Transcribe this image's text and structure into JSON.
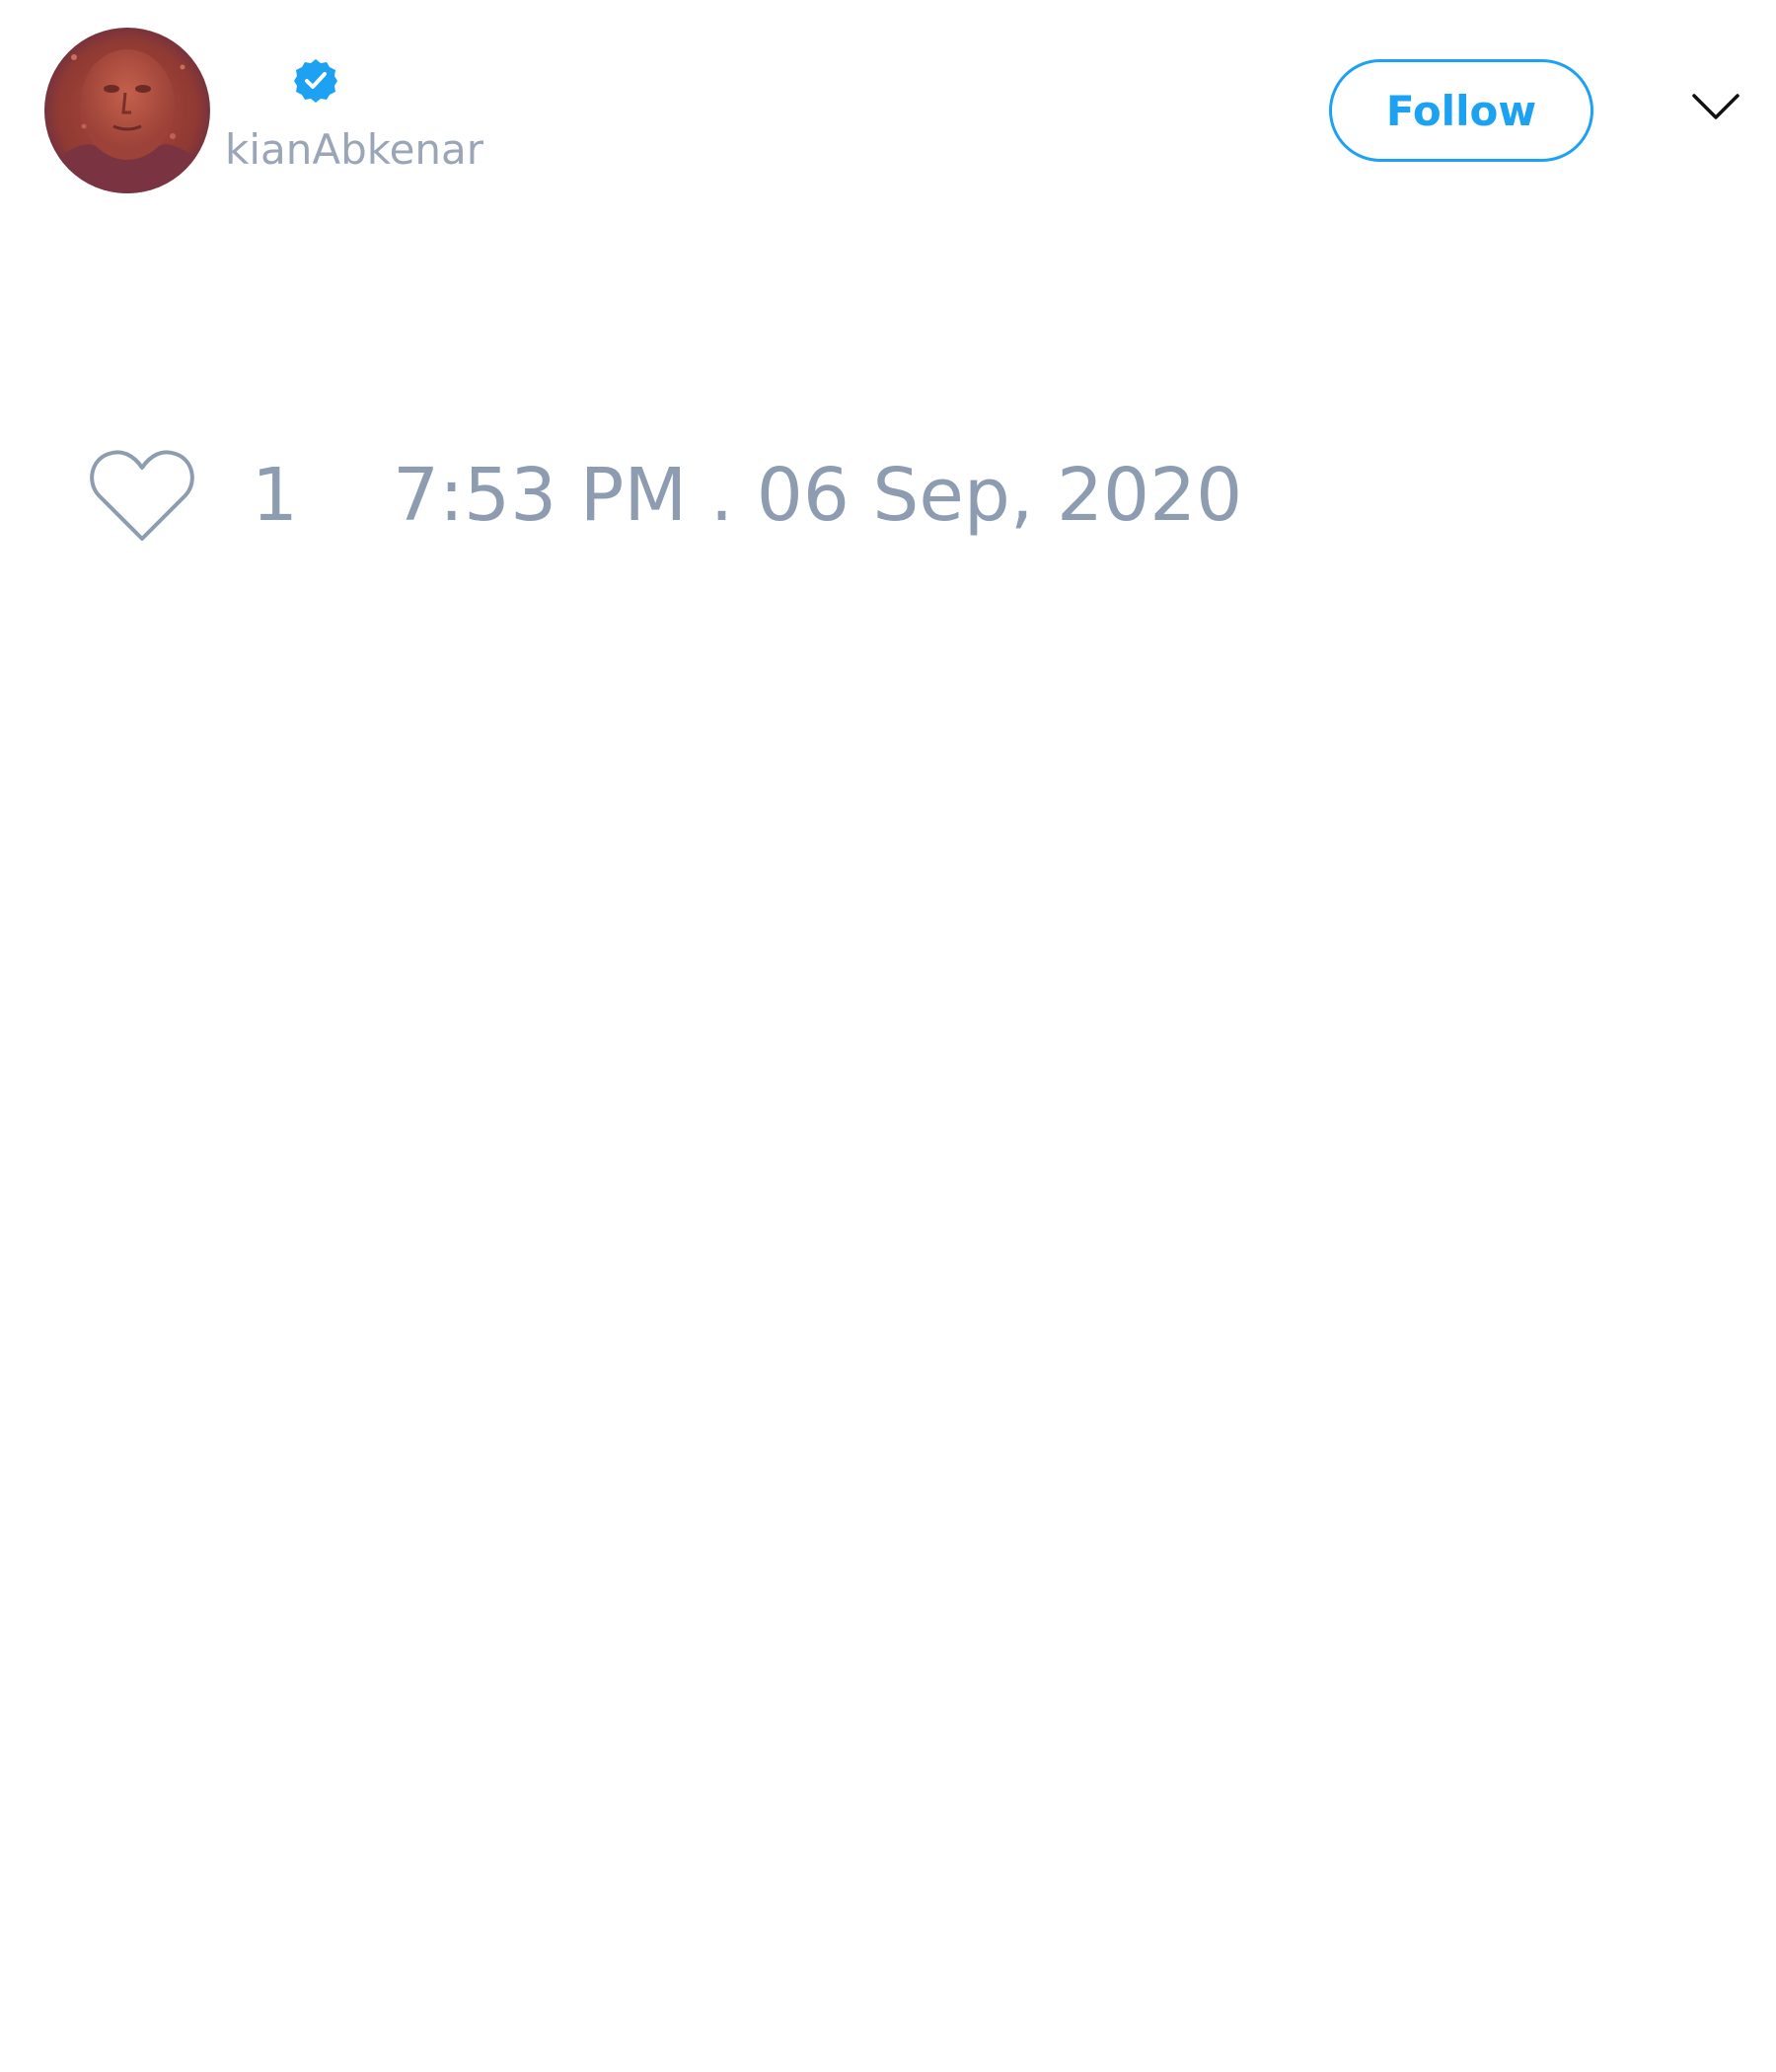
{
  "author": {
    "display_name": "",
    "handle": "kianAbkenar",
    "verified": true,
    "avatar_alt": "profile picture"
  },
  "header": {
    "follow_label": "Follow",
    "menu_icon": "chevron-down-icon"
  },
  "tweet": {
    "like_count": "1",
    "timestamp": "7:53 PM . 06 Sep, 2020"
  },
  "colors": {
    "accent": "#1da1f2",
    "muted_text": "#8d9cb1",
    "handle_text": "#9aa6b8",
    "background": "#ffffff"
  }
}
